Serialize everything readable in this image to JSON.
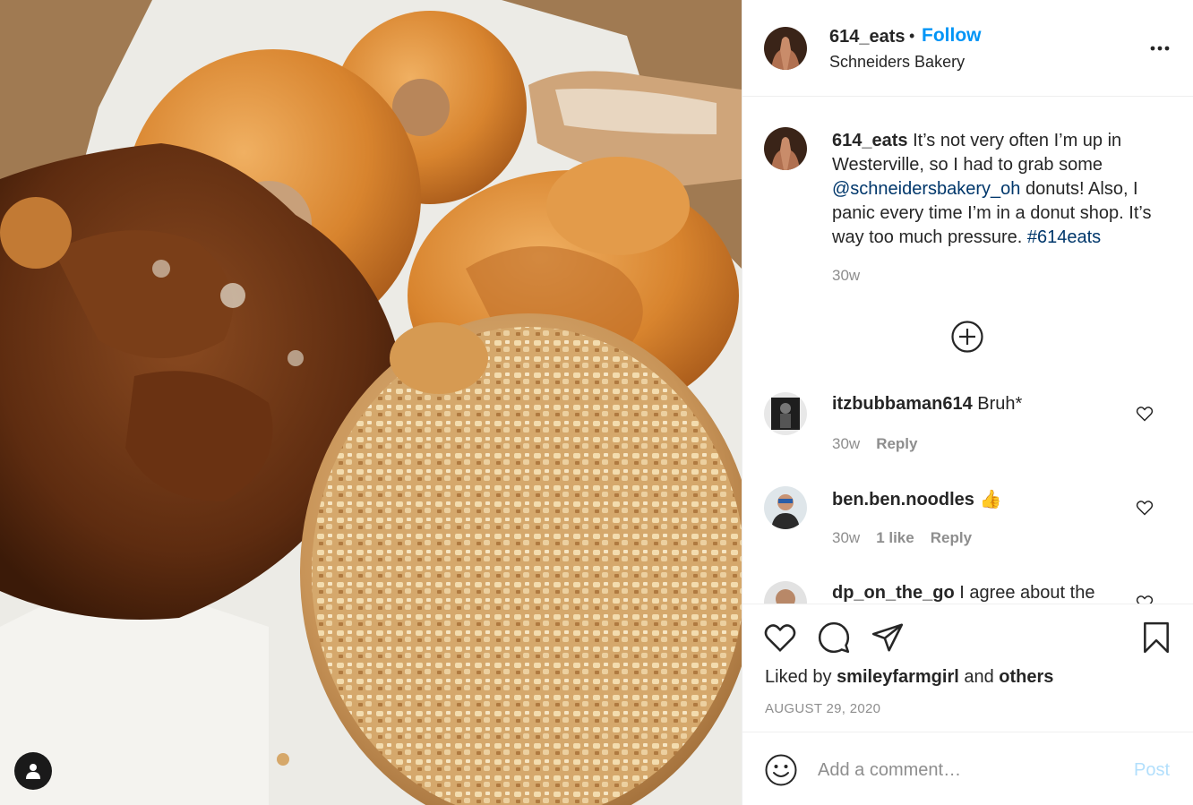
{
  "post": {
    "username": "614_eats",
    "follow_label": "Follow",
    "location": "Schneiders Bakery",
    "caption": {
      "username": "614_eats",
      "text1": " It’s not very often I’m up in Westerville, so I had to grab some ",
      "mention": "@schneidersbakery_oh",
      "text2": " donuts! Also, I panic every time I’m in a donut shop. It’s way too much pressure. ",
      "hashtag": "#614eats",
      "time": "30w"
    },
    "comments": [
      {
        "username": "itzbubbaman614",
        "text": "Bruh*",
        "time": "30w",
        "likes": "",
        "reply": "Reply"
      },
      {
        "username": "ben.ben.noodles",
        "text": "👍",
        "time": "30w",
        "likes": "1 like",
        "reply": "Reply"
      },
      {
        "username": "dp_on_the_go",
        "text": "I agree about the"
      }
    ],
    "liked_by": {
      "prefix": "Liked by ",
      "user": "smileyfarmgirl",
      "middle": " and ",
      "others": "others"
    },
    "date": "AUGUST 29, 2020",
    "add_comment_placeholder": "Add a comment…",
    "post_label": "Post"
  },
  "icons": [
    "tag-user-icon",
    "more-options-icon",
    "load-more-comments-icon",
    "heart-icon",
    "comment-icon",
    "share-icon",
    "bookmark-icon",
    "emoji-icon"
  ],
  "colors": {
    "follow": "#0095f6",
    "link": "#00376b",
    "muted": "#8e8e8e",
    "post_disabled": "#b2dffc"
  }
}
